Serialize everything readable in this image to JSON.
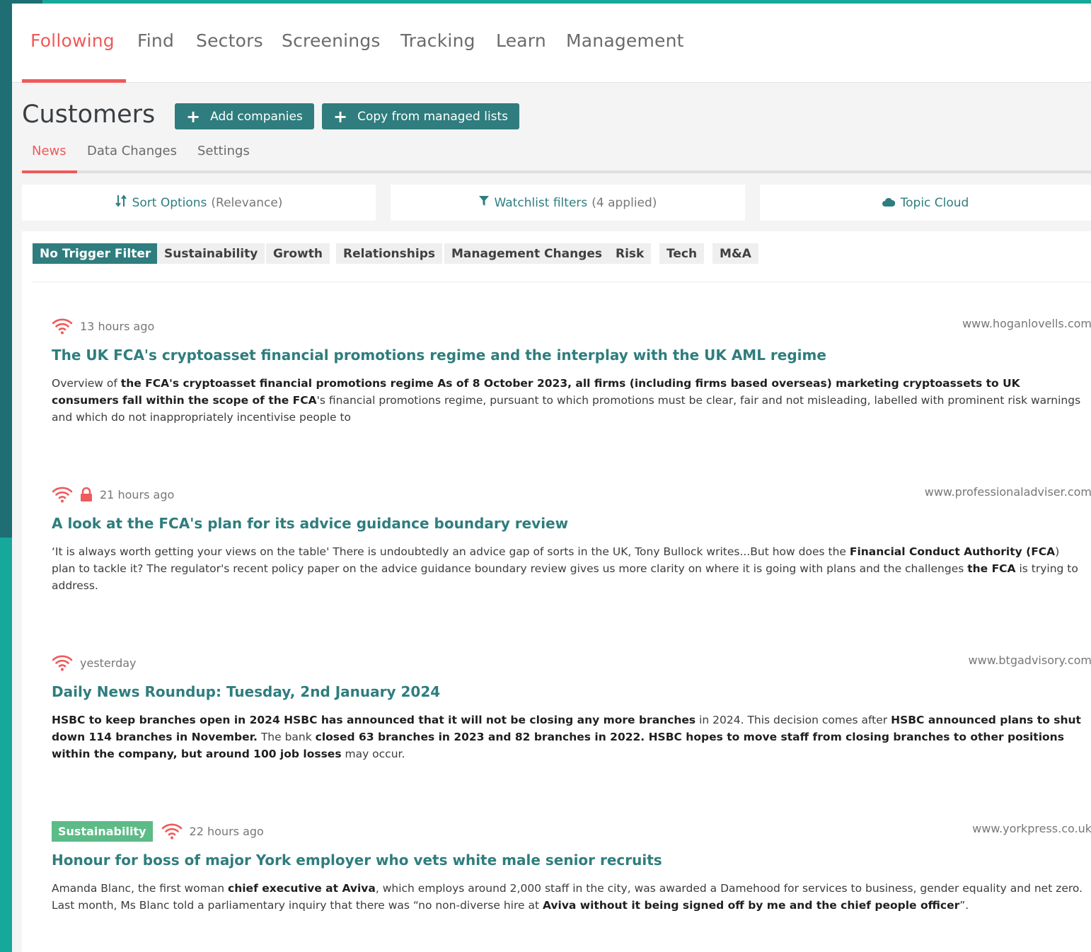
{
  "top_nav": {
    "tabs": [
      {
        "label": "Following",
        "active": true
      },
      {
        "label": "Find"
      },
      {
        "label": "Sectors"
      },
      {
        "label": "Screenings"
      },
      {
        "label": "Tracking"
      },
      {
        "label": "Learn"
      },
      {
        "label": "Management"
      }
    ]
  },
  "header": {
    "title": "Customers",
    "add_companies_label": "Add companies",
    "copy_lists_label": "Copy from managed lists"
  },
  "sub_tabs": [
    {
      "label": "News",
      "active": true
    },
    {
      "label": "Data Changes"
    },
    {
      "label": "Settings"
    }
  ],
  "options": {
    "sort_label": "Sort Options",
    "sort_value": "(Relevance)",
    "filters_label": "Watchlist filters",
    "filters_value": "(4 applied)",
    "topic_cloud_label": "Topic Cloud"
  },
  "trigger_chips": [
    {
      "label": "No Trigger Filter",
      "active": true
    },
    {
      "label": "Sustainability"
    },
    {
      "label": "Growth"
    },
    {
      "label": "Relationships"
    },
    {
      "label": "Management Changes"
    },
    {
      "label": "Risk"
    },
    {
      "label": "Tech"
    },
    {
      "label": "M&A"
    }
  ],
  "colors": {
    "accent_red": "#ef5a5a",
    "brand_teal": "#2f7d7e",
    "tag_green": "#5cbb87"
  },
  "articles": [
    {
      "time": "13 hours ago",
      "source": "www.hoganlovells.com",
      "locked": false,
      "tag": "",
      "headline": "The UK FCA's cryptoasset financial promotions regime and the interplay with the UK AML regime",
      "summary": [
        {
          "t": "Overview of "
        },
        {
          "t": "the FCA's cryptoasset financial promotions regime As of 8 October 2023, all firms (including firms based overseas) marketing cryptoassets to UK consumers fall within the scope of the FCA",
          "b": true
        },
        {
          "t": "'s financial promotions regime, pursuant to which promotions must be clear, fair and not misleading, labelled with prominent risk warnings and which do not inappropriately incentivise people to"
        }
      ]
    },
    {
      "time": "21 hours ago",
      "source": "www.professionaladviser.com",
      "locked": true,
      "tag": "",
      "headline": "A look at the FCA's plan for its advice guidance boundary review",
      "summary": [
        {
          "t": "‘It is always worth getting your views on the table' There is undoubtedly an advice gap of sorts in the UK, Tony Bullock writes...But how does the "
        },
        {
          "t": "Financial Conduct Authority (FCA",
          "b": true
        },
        {
          "t": ") plan to tackle it? The regulator's recent policy paper on the advice guidance boundary review gives us more clarity on where it is going with plans and the challenges "
        },
        {
          "t": "the FCA",
          "b": true
        },
        {
          "t": " is trying to address."
        }
      ]
    },
    {
      "time": "yesterday",
      "source": "www.btgadvisory.com",
      "locked": false,
      "tag": "",
      "headline": "Daily News Roundup: Tuesday, 2nd January 2024",
      "summary": [
        {
          "t": "HSBC to keep branches open in 2024 HSBC has announced that it will not be closing any more branches",
          "b": true
        },
        {
          "t": " in 2024. This decision comes after "
        },
        {
          "t": "HSBC announced plans to shut down 114 branches in November.",
          "b": true
        },
        {
          "t": " The bank "
        },
        {
          "t": "closed 63 branches in 2023 and 82 branches in 2022. HSBC hopes to move staff from closing branches to other positions within the company, but around 100 job losses",
          "b": true
        },
        {
          "t": " may occur."
        }
      ]
    },
    {
      "time": "22 hours ago",
      "source": "www.yorkpress.co.uk",
      "locked": false,
      "tag": "Sustainability",
      "headline": "Honour for boss of major York employer who vets white male senior recruits",
      "summary": [
        {
          "t": "Amanda Blanc, the first woman "
        },
        {
          "t": "chief executive at Aviva",
          "b": true
        },
        {
          "t": ", which employs around 2,000 staff in the city, was awarded a Damehood for services to business, gender equality and net zero. Last month, Ms Blanc told a parliamentary inquiry that there was “no non-diverse hire at "
        },
        {
          "t": "Aviva without it being signed off by me and the chief people officer",
          "b": true
        },
        {
          "t": "”."
        }
      ]
    }
  ]
}
